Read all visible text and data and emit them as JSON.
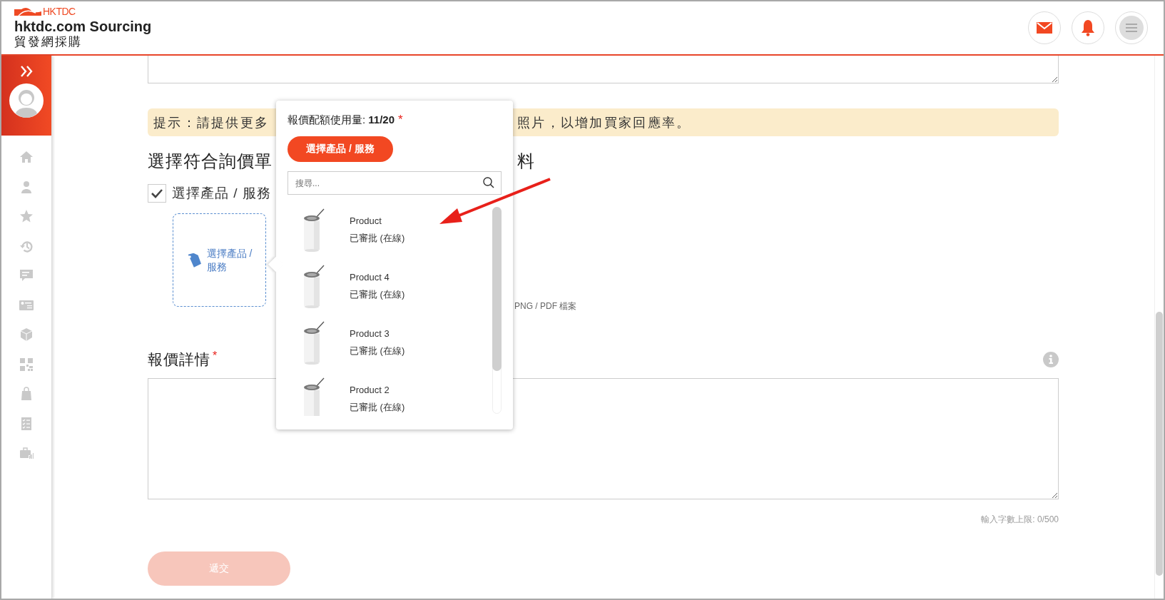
{
  "header": {
    "logo_text": "HKTDC",
    "title": "hktdc.com Sourcing",
    "subtitle": "貿發網採購",
    "actions": [
      {
        "kind": "mail"
      },
      {
        "kind": "bell"
      },
      {
        "kind": "menu"
      }
    ]
  },
  "sidebar": {
    "items": [
      {
        "kind": "home"
      },
      {
        "kind": "person"
      },
      {
        "kind": "star"
      },
      {
        "kind": "history"
      },
      {
        "kind": "chat"
      },
      {
        "kind": "card"
      },
      {
        "kind": "cube"
      },
      {
        "kind": "qr"
      },
      {
        "kind": "bag"
      },
      {
        "kind": "checklist"
      },
      {
        "kind": "briefcase"
      }
    ]
  },
  "tip": {
    "text_before": "提示：請提供更多",
    "text_after": "照片，以增加買家回應率。"
  },
  "section": {
    "heading_before": "選擇符合詢價單",
    "heading_after": "料",
    "checkbox": {
      "label": "選擇產品 / 服務",
      "checked": true
    },
    "picker_card": {
      "label": "選擇產品 / 服務"
    },
    "file_hint": "PNG / PDF 檔案"
  },
  "details": {
    "label": "報價詳情",
    "required_mark": "*",
    "counter": "輸入字數上限: 0/500"
  },
  "submit": {
    "label": "遞交",
    "disabled": true
  },
  "popup": {
    "quota": "報價配額使用量: **11/20**",
    "required_mark": "*",
    "button": "選擇產品 / 服務",
    "search": {
      "placeholder": "搜尋..."
    },
    "products": [
      {
        "name": "Product",
        "status": "已審批 (在線)"
      },
      {
        "name": "Product 4",
        "status": "已審批 (在線)"
      },
      {
        "name": "Product 3",
        "status": "已審批 (在線)"
      },
      {
        "name": "Product 2",
        "status": "已審批 (在線)"
      }
    ]
  },
  "annotation": {
    "kind": "arrow"
  }
}
